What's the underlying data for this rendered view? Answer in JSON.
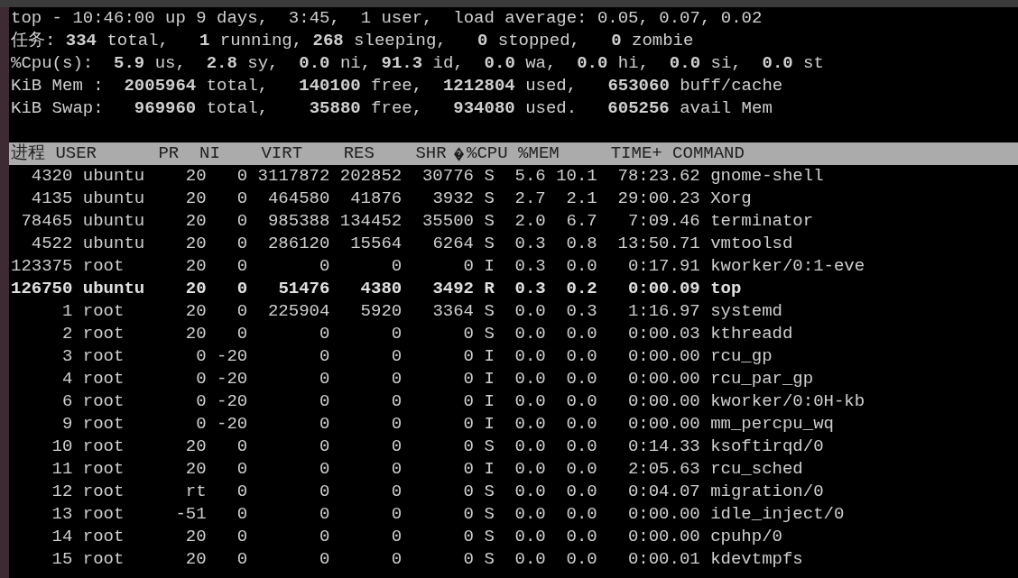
{
  "summary": [
    "top - 10:46:00 up 9 days,  3:45,  1 user,  load average: 0.05, 0.07, 0.02",
    "任务: **334** total,   **1** running, **268** sleeping,   **0** stopped,   **0** zombie",
    "%Cpu(s):  **5.9** us,  **2.8** sy,  **0.0** ni, **91.3** id,  **0.0** wa,  **0.0** hi,  **0.0** si,  **0.0** st",
    "KiB Mem :  **2005964** total,   **140100** free,  **1212804** used,   **653060** buff/cache",
    "KiB Swap:   **969960** total,    **35880** free,   **934080** used.   **605256** avail Mem"
  ],
  "table": {
    "header": {
      "before_sign": "进程 USER      PR  NI    VIRT    RES    SHR",
      "after_sign": "%CPU %MEM     TIME+ COMMAND"
    },
    "rows": [
      {
        "pid": "4320",
        "user": "ubuntu",
        "pr": "20",
        "ni": "0",
        "virt": "3117872",
        "res": "202852",
        "shr": "30776",
        "s": "S",
        "cpu": "5.6",
        "mem": "10.1",
        "time": "78:23.62",
        "command": "gnome-shell",
        "highlighted": false
      },
      {
        "pid": "4135",
        "user": "ubuntu",
        "pr": "20",
        "ni": "0",
        "virt": "464580",
        "res": "41876",
        "shr": "3932",
        "s": "S",
        "cpu": "2.7",
        "mem": "2.1",
        "time": "29:00.23",
        "command": "Xorg",
        "highlighted": false
      },
      {
        "pid": "78465",
        "user": "ubuntu",
        "pr": "20",
        "ni": "0",
        "virt": "985388",
        "res": "134452",
        "shr": "35500",
        "s": "S",
        "cpu": "2.0",
        "mem": "6.7",
        "time": "7:09.46",
        "command": "terminator",
        "highlighted": false
      },
      {
        "pid": "4522",
        "user": "ubuntu",
        "pr": "20",
        "ni": "0",
        "virt": "286120",
        "res": "15564",
        "shr": "6264",
        "s": "S",
        "cpu": "0.3",
        "mem": "0.8",
        "time": "13:50.71",
        "command": "vmtoolsd",
        "highlighted": false
      },
      {
        "pid": "123375",
        "user": "root",
        "pr": "20",
        "ni": "0",
        "virt": "0",
        "res": "0",
        "shr": "0",
        "s": "I",
        "cpu": "0.3",
        "mem": "0.0",
        "time": "0:17.91",
        "command": "kworker/0:1-eve",
        "highlighted": false
      },
      {
        "pid": "126750",
        "user": "ubuntu",
        "pr": "20",
        "ni": "0",
        "virt": "51476",
        "res": "4380",
        "shr": "3492",
        "s": "R",
        "cpu": "0.3",
        "mem": "0.2",
        "time": "0:00.09",
        "command": "top",
        "highlighted": true
      },
      {
        "pid": "1",
        "user": "root",
        "pr": "20",
        "ni": "0",
        "virt": "225904",
        "res": "5920",
        "shr": "3364",
        "s": "S",
        "cpu": "0.0",
        "mem": "0.3",
        "time": "1:16.97",
        "command": "systemd",
        "highlighted": false
      },
      {
        "pid": "2",
        "user": "root",
        "pr": "20",
        "ni": "0",
        "virt": "0",
        "res": "0",
        "shr": "0",
        "s": "S",
        "cpu": "0.0",
        "mem": "0.0",
        "time": "0:00.03",
        "command": "kthreadd",
        "highlighted": false
      },
      {
        "pid": "3",
        "user": "root",
        "pr": "0",
        "ni": "-20",
        "virt": "0",
        "res": "0",
        "shr": "0",
        "s": "I",
        "cpu": "0.0",
        "mem": "0.0",
        "time": "0:00.00",
        "command": "rcu_gp",
        "highlighted": false
      },
      {
        "pid": "4",
        "user": "root",
        "pr": "0",
        "ni": "-20",
        "virt": "0",
        "res": "0",
        "shr": "0",
        "s": "I",
        "cpu": "0.0",
        "mem": "0.0",
        "time": "0:00.00",
        "command": "rcu_par_gp",
        "highlighted": false
      },
      {
        "pid": "6",
        "user": "root",
        "pr": "0",
        "ni": "-20",
        "virt": "0",
        "res": "0",
        "shr": "0",
        "s": "I",
        "cpu": "0.0",
        "mem": "0.0",
        "time": "0:00.00",
        "command": "kworker/0:0H-kb",
        "highlighted": false
      },
      {
        "pid": "9",
        "user": "root",
        "pr": "0",
        "ni": "-20",
        "virt": "0",
        "res": "0",
        "shr": "0",
        "s": "I",
        "cpu": "0.0",
        "mem": "0.0",
        "time": "0:00.00",
        "command": "mm_percpu_wq",
        "highlighted": false
      },
      {
        "pid": "10",
        "user": "root",
        "pr": "20",
        "ni": "0",
        "virt": "0",
        "res": "0",
        "shr": "0",
        "s": "S",
        "cpu": "0.0",
        "mem": "0.0",
        "time": "0:14.33",
        "command": "ksoftirqd/0",
        "highlighted": false
      },
      {
        "pid": "11",
        "user": "root",
        "pr": "20",
        "ni": "0",
        "virt": "0",
        "res": "0",
        "shr": "0",
        "s": "I",
        "cpu": "0.0",
        "mem": "0.0",
        "time": "2:05.63",
        "command": "rcu_sched",
        "highlighted": false
      },
      {
        "pid": "12",
        "user": "root",
        "pr": "rt",
        "ni": "0",
        "virt": "0",
        "res": "0",
        "shr": "0",
        "s": "S",
        "cpu": "0.0",
        "mem": "0.0",
        "time": "0:04.07",
        "command": "migration/0",
        "highlighted": false
      },
      {
        "pid": "13",
        "user": "root",
        "pr": "-51",
        "ni": "0",
        "virt": "0",
        "res": "0",
        "shr": "0",
        "s": "S",
        "cpu": "0.0",
        "mem": "0.0",
        "time": "0:00.00",
        "command": "idle_inject/0",
        "highlighted": false
      },
      {
        "pid": "14",
        "user": "root",
        "pr": "20",
        "ni": "0",
        "virt": "0",
        "res": "0",
        "shr": "0",
        "s": "S",
        "cpu": "0.0",
        "mem": "0.0",
        "time": "0:00.00",
        "command": "cpuhp/0",
        "highlighted": false
      },
      {
        "pid": "15",
        "user": "root",
        "pr": "20",
        "ni": "0",
        "virt": "0",
        "res": "0",
        "shr": "0",
        "s": "S",
        "cpu": "0.0",
        "mem": "0.0",
        "time": "0:00.01",
        "command": "kdevtmpfs",
        "highlighted": false
      }
    ]
  }
}
